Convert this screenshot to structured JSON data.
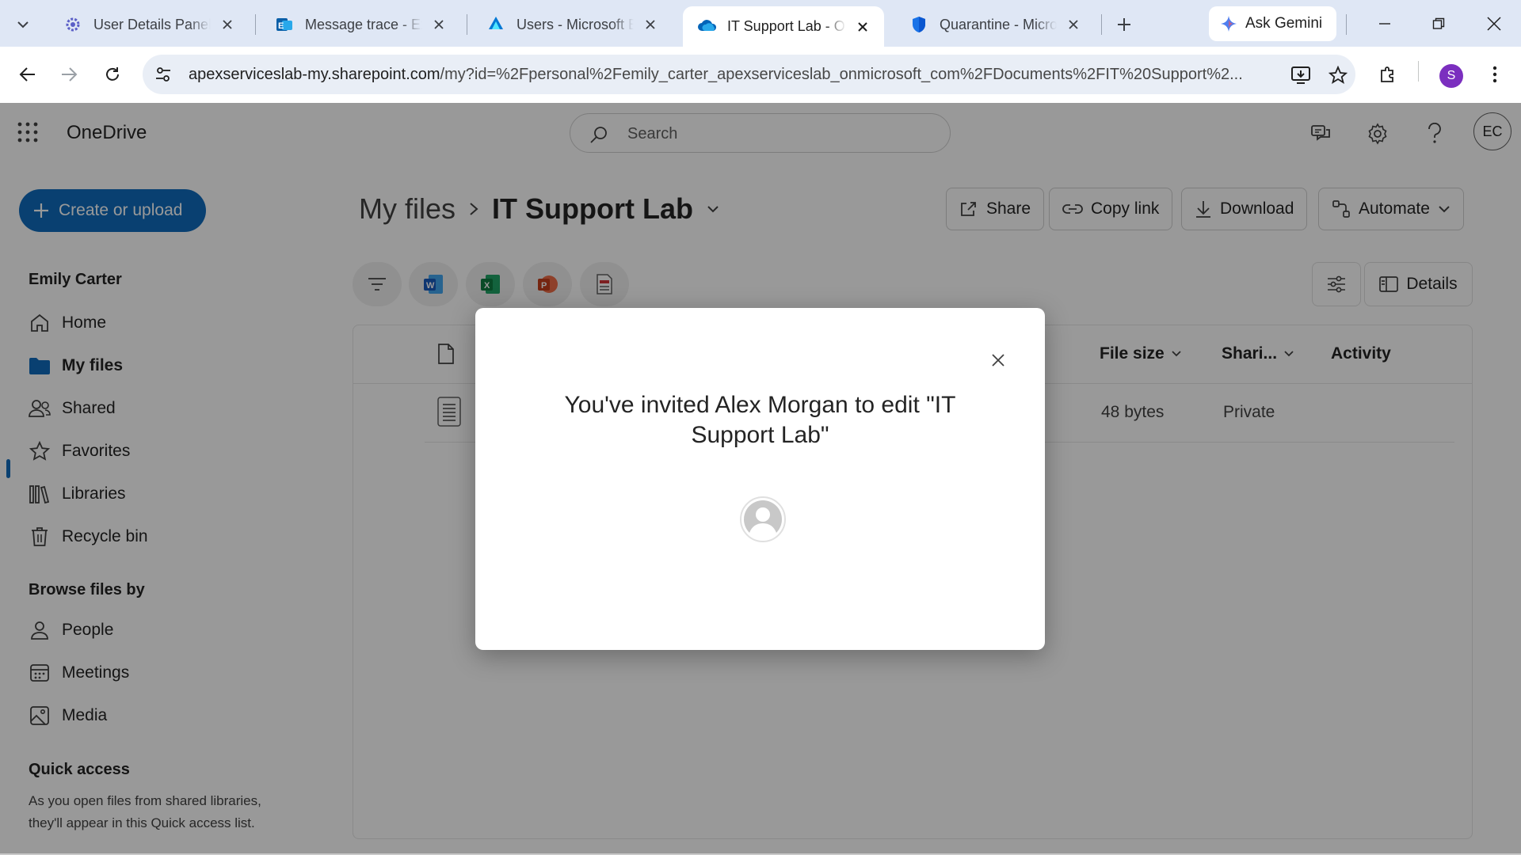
{
  "browser": {
    "tabs": [
      {
        "title": "User Details Panel - ",
        "icon": "gear-icon"
      },
      {
        "title": "Message trace - Excl",
        "icon": "exchange-icon"
      },
      {
        "title": "Users - Microsoft En",
        "icon": "entra-icon"
      },
      {
        "title": "IT Support Lab - One",
        "icon": "onedrive-icon",
        "active": true
      },
      {
        "title": "Quarantine - Micros",
        "icon": "defender-shield-icon"
      }
    ],
    "ask_gemini": "Ask Gemini",
    "url_domain": "apexserviceslab-my.sharepoint.com",
    "url_rest": "/my?id=%2Fpersonal%2Femily_carter_apexserviceslab_onmicrosoft_com%2FDocuments%2FIT%20Support%2...",
    "profile_initial": "S"
  },
  "app": {
    "name": "OneDrive",
    "search_placeholder": "Search",
    "me_initials": "EC",
    "create_button": "Create or upload"
  },
  "leftnav": {
    "user_name": "Emily Carter",
    "items": [
      {
        "label": "Home",
        "icon": "home-icon"
      },
      {
        "label": "My files",
        "icon": "folder-icon",
        "active": true
      },
      {
        "label": "Shared",
        "icon": "people-icon"
      },
      {
        "label": "Favorites",
        "icon": "star-icon"
      },
      {
        "label": "Libraries",
        "icon": "library-icon"
      },
      {
        "label": "Recycle bin",
        "icon": "trash-icon"
      }
    ],
    "browse_heading": "Browse files by",
    "browse_items": [
      {
        "label": "People",
        "icon": "person-icon"
      },
      {
        "label": "Meetings",
        "icon": "calendar-icon"
      },
      {
        "label": "Media",
        "icon": "image-icon"
      }
    ],
    "quick_access_heading": "Quick access",
    "quick_access_text": "As you open files from shared libraries, they'll appear in this Quick access list."
  },
  "main": {
    "breadcrumb_root": "My files",
    "breadcrumb_current": "IT Support Lab",
    "commands": {
      "share": "Share",
      "copy_link": "Copy link",
      "download": "Download",
      "automate": "Automate"
    },
    "details": "Details",
    "columns": {
      "file_size": "File size",
      "sharing": "Shari...",
      "activity": "Activity"
    },
    "row": {
      "file_size": "48 bytes",
      "sharing": "Private"
    }
  },
  "dialog": {
    "title": "You've invited Alex Morgan to edit \"IT Support Lab\""
  },
  "colors": {
    "accent": "#0f6cbd",
    "tabstrip": "#dfe7f5"
  }
}
